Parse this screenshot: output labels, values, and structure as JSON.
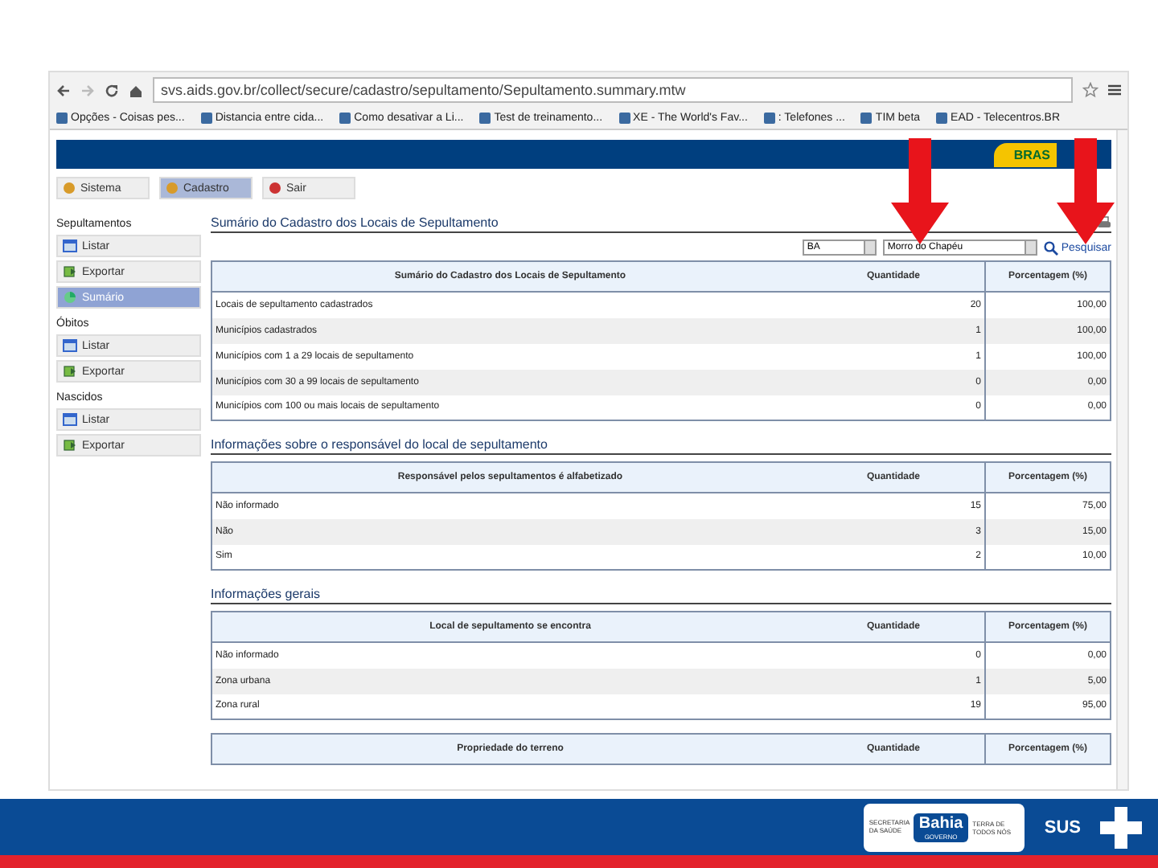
{
  "browser": {
    "url": "svs.aids.gov.br/collect/secure/cadastro/sepultamento/Sepultamento.summary.mtw",
    "bookmarks": [
      "Opções - Coisas pes...",
      "Distancia entre cida...",
      "Como desativar a Li...",
      "Test de treinamento...",
      "XE - The World's Fav...",
      ": Telefones ...",
      "TIM beta",
      "EAD - Telecentros.BR"
    ]
  },
  "banner": {
    "text": "BRAS"
  },
  "top_tabs": [
    {
      "label": "Sistema",
      "selected": false
    },
    {
      "label": "Cadastro",
      "selected": true
    },
    {
      "label": "Sair",
      "selected": false
    }
  ],
  "sidebar": [
    {
      "title": "Sepultamentos",
      "items": [
        {
          "label": "Listar",
          "selected": false,
          "kind": "list"
        },
        {
          "label": "Exportar",
          "selected": false,
          "kind": "export"
        },
        {
          "label": "Sumário",
          "selected": true,
          "kind": "summary"
        }
      ]
    },
    {
      "title": "Óbitos",
      "items": [
        {
          "label": "Listar",
          "selected": false,
          "kind": "list"
        },
        {
          "label": "Exportar",
          "selected": false,
          "kind": "export"
        }
      ]
    },
    {
      "title": "Nascidos",
      "items": [
        {
          "label": "Listar",
          "selected": false,
          "kind": "list"
        },
        {
          "label": "Exportar",
          "selected": false,
          "kind": "export"
        }
      ]
    }
  ],
  "filters": {
    "state": "BA",
    "municipality": "Morro do Chapéu",
    "search": "Pesquisar"
  },
  "sections": [
    {
      "title": "Sumário do Cadastro dos Locais de Sepultamento",
      "tables": [
        {
          "columns": [
            "Sumário do Cadastro dos Locais de Sepultamento",
            "Quantidade",
            "Porcentagem (%)"
          ],
          "rows": [
            [
              "Locais de sepultamento cadastrados",
              "20",
              "100,00"
            ],
            [
              "Municípios cadastrados",
              "1",
              "100,00"
            ],
            [
              "Municípios com 1 a 29 locais de sepultamento",
              "1",
              "100,00"
            ],
            [
              "Municípios com 30 a 99 locais de sepultamento",
              "0",
              "0,00"
            ],
            [
              "Municípios com 100 ou mais locais de sepultamento",
              "0",
              "0,00"
            ]
          ]
        }
      ]
    },
    {
      "title": "Informações sobre o responsável do local de sepultamento",
      "tables": [
        {
          "columns": [
            "Responsável pelos sepultamentos é alfabetizado",
            "Quantidade",
            "Porcentagem (%)"
          ],
          "rows": [
            [
              "Não informado",
              "15",
              "75,00"
            ],
            [
              "Não",
              "3",
              "15,00"
            ],
            [
              "Sim",
              "2",
              "10,00"
            ]
          ]
        }
      ]
    },
    {
      "title": "Informações gerais",
      "tables": [
        {
          "columns": [
            "Local de sepultamento se encontra",
            "Quantidade",
            "Porcentagem (%)"
          ],
          "rows": [
            [
              "Não informado",
              "0",
              "0,00"
            ],
            [
              "Zona urbana",
              "1",
              "5,00"
            ],
            [
              "Zona rural",
              "19",
              "95,00"
            ]
          ]
        },
        {
          "columns": [
            "Propriedade do terreno",
            "Quantidade",
            "Porcentagem (%)"
          ]
        }
      ]
    }
  ],
  "footer": {
    "secretaria": "SECRETARIA DA SAÚDE",
    "state": "Bahia",
    "governo": "GOVERNO",
    "motto": "TERRA DE TODOS NÓS",
    "sus": "SUS"
  }
}
